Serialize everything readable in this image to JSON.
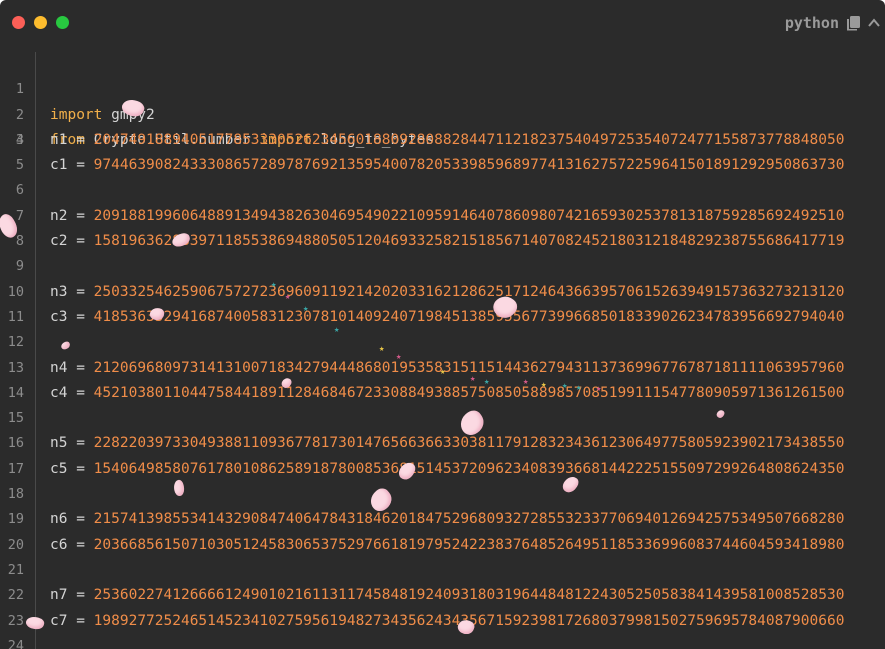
{
  "window": {
    "language_label": "python",
    "colors": {
      "background": "#2b2b2b",
      "keyword": "#f2b04a",
      "number": "#f08d49",
      "text": "#d4d4d4",
      "line_number": "#8c8c8c"
    }
  },
  "icons": {
    "copy": "copy-icon",
    "collapse": "chevron-up-icon"
  },
  "code": {
    "kw_import": "import",
    "mod_gmpy2": " gmpy2",
    "kw_from": "from",
    "mod_crypto": " Crypto.Util.number ",
    "fn_ltb": " long_to_bytes",
    "assign": " = ",
    "vars": [
      "n1",
      "c1",
      "n2",
      "c2",
      "n3",
      "c3",
      "n4",
      "c4",
      "n5",
      "c5",
      "n6",
      "c6",
      "n7",
      "c7"
    ],
    "values": [
      "20474918894051778533305262345601880928088284471121823754049725354072477155873778848050",
      "97446390824333086572897876921359540078205339859689774131627572259641501891292950863730",
      "20918819960648891349438263046954902210959146407860980742165930253781318759285692492510",
      "15819636288397118553869488050512046933258215185671407082452180312184829238755686417719",
      "25033254625906757272369609119214202033162128625171246436639570615263949157363273213120",
      "41853635294168740058312307810140924071984513859556773996685018339026234783956692794040",
      "21206968097314131007183427944486801953583151151443627943113736996776787181111063957960",
      "45210380110447584418911284684672330884938857508505889857085199111547780905971361261500",
      "22822039733049388110936778173014765663663303811791283234361230649775805923902173438550",
      "15406498580761780108625891878008536815145372096234083936681442225155097299264808624350",
      "21574139855341432908474064784318462018475296809327285532337706940126942575349507668280",
      "20366856150710305124583065375297661819795242238376485264951185336996083744604593418980",
      "25360227412666612490102161131174584819240931803196448481224305250583841439581008528530",
      "19892772524651452341027595619482734356243435671592398172680379981502759695784087900660"
    ]
  },
  "line_numbers": [
    "1",
    "2",
    "3",
    "4",
    "5",
    "6",
    "7",
    "8",
    "9",
    "10",
    "11",
    "12",
    "13",
    "14",
    "15",
    "16",
    "17",
    "18",
    "19",
    "20",
    "21",
    "22",
    "23",
    "24"
  ]
}
